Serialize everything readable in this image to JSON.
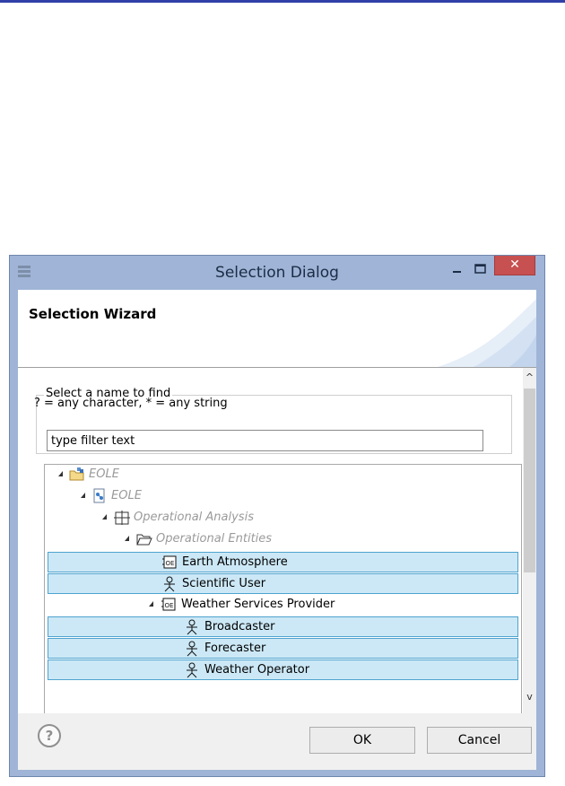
{
  "window": {
    "title": "Selection Dialog",
    "close_glyph": "✕",
    "sysmenu_icon": "app-menu-icon"
  },
  "banner": {
    "title": "Selection Wizard"
  },
  "filter": {
    "group_label": "Select a name to find",
    "hint": "? = any character, * = any string",
    "value": "type filter text"
  },
  "tree": {
    "items": [
      {
        "label": "EOLE",
        "icon": "project-folder-icon",
        "style": "gray"
      },
      {
        "label": "EOLE",
        "icon": "model-icon",
        "style": "gray"
      },
      {
        "label": "Operational Analysis",
        "icon": "grid-icon",
        "style": "gray"
      },
      {
        "label": "Operational Entities",
        "icon": "folder-icon",
        "style": "gray"
      },
      {
        "label": "Earth Atmosphere",
        "icon": "entity-icon",
        "style": "selected"
      },
      {
        "label": "Scientific User",
        "icon": "actor-icon",
        "style": "selected"
      },
      {
        "label": "Weather Services Provider",
        "icon": "entity-icon",
        "style": "normal"
      },
      {
        "label": "Broadcaster",
        "icon": "actor-icon",
        "style": "selected"
      },
      {
        "label": "Forecaster",
        "icon": "actor-icon",
        "style": "selected"
      },
      {
        "label": "Weather Operator",
        "icon": "actor-icon",
        "style": "selected"
      }
    ]
  },
  "footer": {
    "help_glyph": "?",
    "ok_label": "OK",
    "cancel_label": "Cancel"
  },
  "scrollbar": {
    "up_glyph": "^",
    "down_glyph": "v"
  },
  "colors": {
    "selection_fill": "#cce8f6",
    "selection_border": "#4fa3cf",
    "close_button": "#c75050",
    "frame": "#9fb4d6"
  }
}
